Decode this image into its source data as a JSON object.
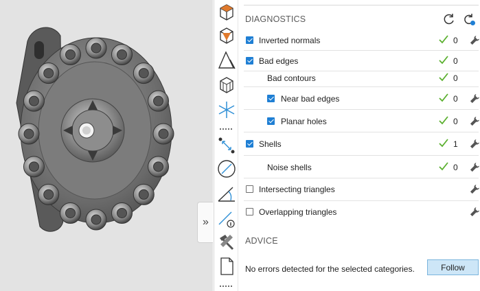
{
  "viewport": {
    "expand_glyph": "»",
    "expand_icon": "double-chevron-right-icon"
  },
  "toolbar": {
    "tools": [
      {
        "icon": "box-view-icon"
      },
      {
        "icon": "box-select-icon"
      },
      {
        "icon": "triangle-measure-icon"
      },
      {
        "icon": "box-wireframe-icon"
      },
      {
        "icon": "snowflake-icon"
      },
      {
        "icon": "more-dots-icon"
      },
      {
        "icon": "point-distance-icon"
      },
      {
        "icon": "diameter-icon"
      },
      {
        "icon": "angle-icon"
      },
      {
        "icon": "distance-info-icon"
      },
      {
        "icon": "hammer-tools-icon"
      },
      {
        "icon": "document-icon"
      },
      {
        "icon": "more-dots-icon"
      }
    ]
  },
  "diagnostics": {
    "title": "DIAGNOSTICS",
    "refresh_icon": "refresh-icon",
    "refresh_all_icon": "refresh-settings-icon",
    "rows": [
      {
        "label": "Inverted normals",
        "checkbox": true,
        "checked": true,
        "indent": 0,
        "status_ok": true,
        "count": "0",
        "fix": true
      },
      {
        "label": "Bad edges",
        "checkbox": true,
        "checked": true,
        "indent": 0,
        "status_ok": true,
        "count": "0",
        "fix": false
      },
      {
        "label": "Bad contours",
        "checkbox": false,
        "checked": false,
        "indent": 1,
        "status_ok": true,
        "count": "0",
        "fix": false
      },
      {
        "label": "Near bad edges",
        "checkbox": true,
        "checked": true,
        "indent": 1,
        "status_ok": true,
        "count": "0",
        "fix": true
      },
      {
        "label": "Planar holes",
        "checkbox": true,
        "checked": true,
        "indent": 1,
        "status_ok": true,
        "count": "0",
        "fix": true
      },
      {
        "label": "Shells",
        "checkbox": true,
        "checked": true,
        "indent": 0,
        "status_ok": true,
        "count": "1",
        "fix": true
      },
      {
        "label": "Noise shells",
        "checkbox": false,
        "checked": false,
        "indent": 1,
        "status_ok": true,
        "count": "0",
        "fix": true
      },
      {
        "label": "Intersecting triangles",
        "checkbox": true,
        "checked": false,
        "indent": 0,
        "status_ok": false,
        "count": "",
        "fix": true
      },
      {
        "label": "Overlapping triangles",
        "checkbox": true,
        "checked": false,
        "indent": 0,
        "status_ok": false,
        "count": "",
        "fix": true
      }
    ]
  },
  "advice": {
    "title": "ADVICE",
    "message": "No errors detected for the selected categories.",
    "follow_label": "Follow"
  },
  "colors": {
    "accent": "#1f7fd4",
    "ok_green": "#5bb02f",
    "follow_bg": "#cde6f7",
    "viewport_bg": "#e3e3e3"
  }
}
